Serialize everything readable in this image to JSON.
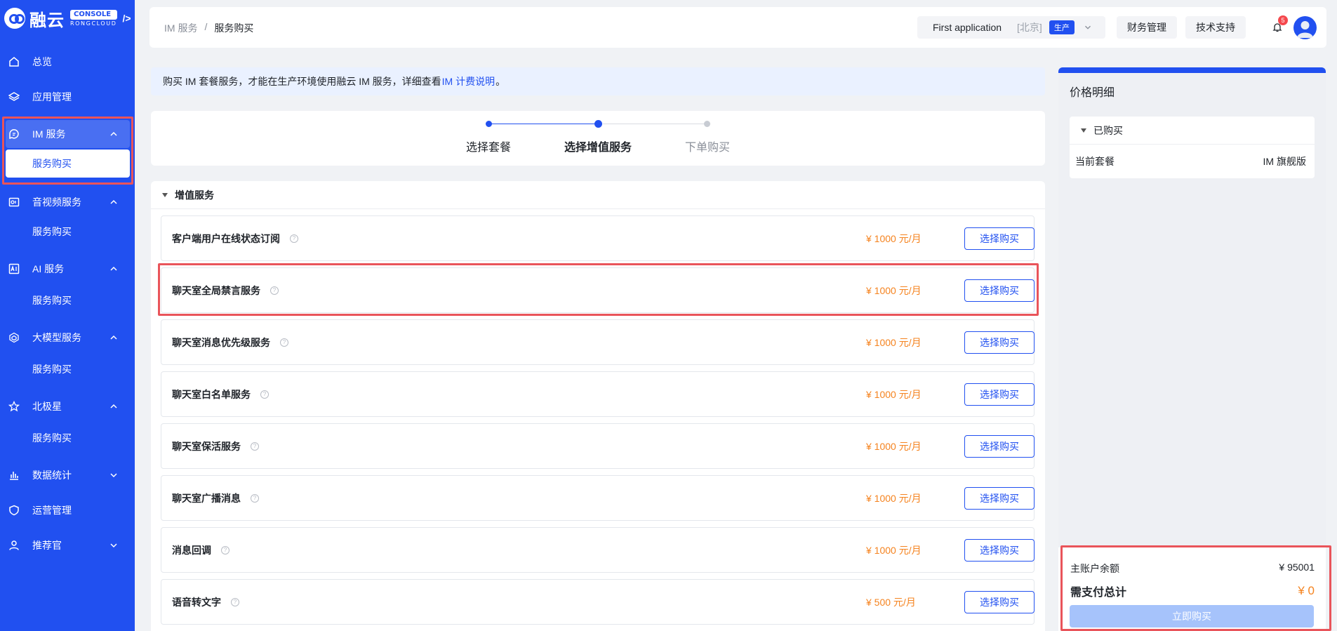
{
  "brand": {
    "name": "融云",
    "console": "CONSOLE",
    "sub": "RONGCLOUD"
  },
  "sidebar": {
    "overview": "总览",
    "apps": "应用管理",
    "im": "IM 服务",
    "im_buy": "服务购买",
    "av": "音视频服务",
    "av_buy": "服务购买",
    "ai": "AI 服务",
    "ai_buy": "服务购买",
    "llm": "大模型服务",
    "llm_buy": "服务购买",
    "polaris": "北极星",
    "polaris_buy": "服务购买",
    "stats": "数据统计",
    "ops": "运营管理",
    "referral": "推荐官"
  },
  "header": {
    "breadcrumb_parent": "IM 服务",
    "breadcrumb_sep": "/",
    "breadcrumb_current": "服务购买",
    "app_name": "First application",
    "app_region": "[北京]",
    "app_env": "生产",
    "finance": "财务管理",
    "support": "技术支持",
    "notify_count": "5"
  },
  "notice": {
    "text_before": "购买 IM 套餐服务，才能在生产环境使用融云 IM 服务，详细查看",
    "link": "IM 计费说明",
    "text_after": "。"
  },
  "steps": [
    "选择套餐",
    "选择增值服务",
    "下单购买"
  ],
  "services": {
    "title": "增值服务",
    "buy_label": "选择购买",
    "help_glyph": "?",
    "items": [
      {
        "name": "客户端用户在线状态订阅",
        "price": "¥ 1000 元/月"
      },
      {
        "name": "聊天室全局禁言服务",
        "price": "¥ 1000 元/月"
      },
      {
        "name": "聊天室消息优先级服务",
        "price": "¥ 1000 元/月"
      },
      {
        "name": "聊天室白名单服务",
        "price": "¥ 1000 元/月"
      },
      {
        "name": "聊天室保活服务",
        "price": "¥ 1000 元/月"
      },
      {
        "name": "聊天室广播消息",
        "price": "¥ 1000 元/月"
      },
      {
        "name": "消息回调",
        "price": "¥ 1000 元/月"
      },
      {
        "name": "语音转文字",
        "price": "¥ 500 元/月"
      }
    ]
  },
  "price_panel": {
    "title": "价格明细",
    "purchased": "已购买",
    "current_plan_label": "当前套餐",
    "current_plan_value": "IM 旗舰版",
    "balance_label": "主账户余额",
    "balance_value": "¥ 95001",
    "total_label": "需支付总计",
    "total_value": "¥ 0",
    "pay_button": "立即购买"
  },
  "colors": {
    "primary": "#2150f0",
    "price": "#f5831f",
    "highlight": "#e9545a"
  }
}
